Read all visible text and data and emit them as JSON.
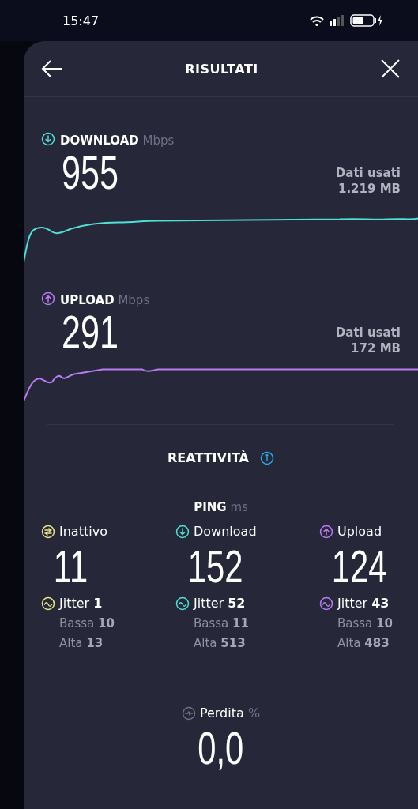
{
  "status_bar": {
    "time": "15:47"
  },
  "header": {
    "title": "RISULTATI"
  },
  "speed": [
    {
      "kind": "download",
      "label": "DOWNLOAD",
      "unit": "Mbps",
      "value": "955",
      "data_label": "Dati usati",
      "data_value": "1.219 MB",
      "color": "#4fe0d5"
    },
    {
      "kind": "upload",
      "label": "UPLOAD",
      "unit": "Mbps",
      "value": "291",
      "data_label": "Dati usati",
      "data_value": "172 MB",
      "color": "#b77cf0"
    }
  ],
  "responsiveness": {
    "title": "REATTIVITÀ",
    "ping_label": "PING",
    "ping_unit": "ms",
    "columns": [
      {
        "kind": "idle",
        "label": "Inattivo",
        "value": "11",
        "jitter": "Jitter **1**",
        "low": "Bassa **10**",
        "high": "Alta **13**",
        "color": "#ece48a"
      },
      {
        "kind": "download",
        "label": "Download",
        "value": "152",
        "jitter": "Jitter **52**",
        "low": "Bassa **11**",
        "high": "Alta **513**",
        "color": "#4fe0d5"
      },
      {
        "kind": "upload",
        "label": "Upload",
        "value": "124",
        "jitter": "Jitter **43**",
        "low": "Bassa **10**",
        "high": "Alta **483**",
        "color": "#b77cf0"
      }
    ],
    "loss": {
      "label": "Perdita",
      "unit": "%",
      "value": "0,0"
    }
  }
}
